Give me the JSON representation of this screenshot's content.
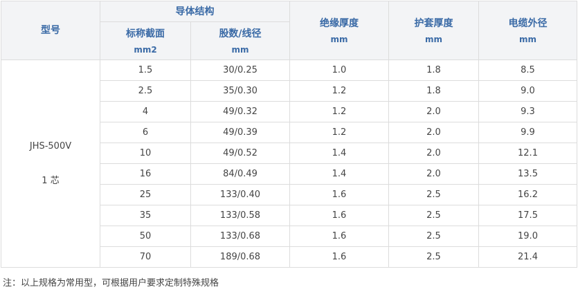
{
  "header": {
    "model": "型号",
    "conductor_group": "导体结构",
    "cross_section": "标称截面",
    "cross_section_unit": "mm2",
    "strand": "股数/线径",
    "strand_unit": "mm",
    "insulation": "绝缘厚度",
    "insulation_unit": "mm",
    "sheath": "护套厚度",
    "sheath_unit": "mm",
    "diameter": "电缆外径",
    "diameter_unit": "mm"
  },
  "spec": {
    "model": "JHS-500V",
    "cores": "1 芯"
  },
  "rows": [
    {
      "section": "1.5",
      "strand": "30/0.25",
      "insulation": "1.0",
      "sheath": "1.8",
      "diameter": "8.5"
    },
    {
      "section": "2.5",
      "strand": "35/0.30",
      "insulation": "1.2",
      "sheath": "1.8",
      "diameter": "9.0"
    },
    {
      "section": "4",
      "strand": "49/0.32",
      "insulation": "1.2",
      "sheath": "2.0",
      "diameter": "9.3"
    },
    {
      "section": "6",
      "strand": "49/0.39",
      "insulation": "1.2",
      "sheath": "2.0",
      "diameter": "9.9"
    },
    {
      "section": "10",
      "strand": "49/0.52",
      "insulation": "1.4",
      "sheath": "2.0",
      "diameter": "12.1"
    },
    {
      "section": "16",
      "strand": "84/0.49",
      "insulation": "1.4",
      "sheath": "2.0",
      "diameter": "13.5"
    },
    {
      "section": "25",
      "strand": "133/0.40",
      "insulation": "1.6",
      "sheath": "2.5",
      "diameter": "16.2"
    },
    {
      "section": "35",
      "strand": "133/0.58",
      "insulation": "1.6",
      "sheath": "2.5",
      "diameter": "17.5"
    },
    {
      "section": "50",
      "strand": "133/0.68",
      "insulation": "1.6",
      "sheath": "2.5",
      "diameter": "19.0"
    },
    {
      "section": "70",
      "strand": "189/0.68",
      "insulation": "1.6",
      "sheath": "2.5",
      "diameter": "21.4"
    }
  ],
  "note": "注：以上规格为常用型，可根据用户要求定制特殊规格"
}
